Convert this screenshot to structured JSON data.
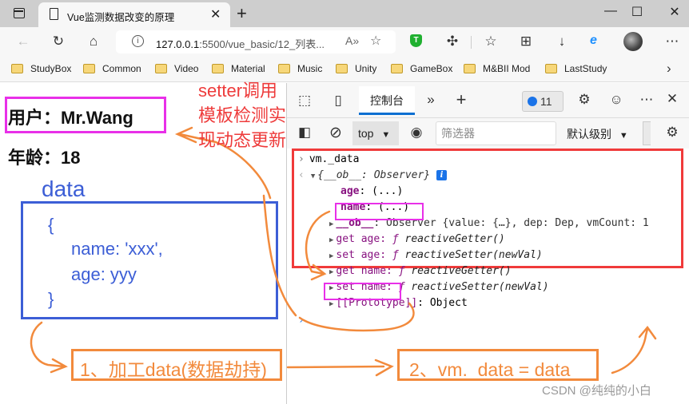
{
  "browser": {
    "tab_title": "Vue监测数据改变的原理",
    "url_host": "127.0.0.1",
    "url_rest": ":5500/vue_basic/12_列表...",
    "bookmarks": [
      "StudyBox",
      "Common",
      "Video",
      "Material",
      "Music",
      "Unity",
      "GameBox",
      "M&BII Mod",
      "LastStudy"
    ]
  },
  "page": {
    "user_label": "用户：Mr.Wang",
    "age_label": "年龄：18"
  },
  "annotations": {
    "setter_note": [
      "setter调用",
      "模板检测实",
      "现动态更新"
    ],
    "data_title": "data",
    "data_object": [
      "{",
      "name: 'xxx',",
      "age: yyy",
      "}"
    ],
    "step1": "1、加工data(数据劫持)",
    "step2": "2、vm._data = data",
    "colors": {
      "red": "#ee3b3b",
      "magenta": "#e830e8",
      "blue": "#3c5ed6",
      "orange": "#f28a3c"
    }
  },
  "devtools": {
    "console_tab": "控制台",
    "issues_count": "11",
    "context": "top",
    "filter_placeholder": "筛选器",
    "level": "默认级别",
    "input": "vm._data",
    "object_summary": "{__ob__: Observer}",
    "lines": [
      {
        "key": "age",
        "value": ": (...)"
      },
      {
        "key": "name",
        "value": ": (...)"
      },
      {
        "key": "__ob__",
        "value": ": Observer {value: {…}, dep: Dep, vmCount: 1"
      },
      {
        "key": "get age",
        "value": "reactiveGetter()"
      },
      {
        "key": "set age",
        "value": "reactiveSetter(newVal)"
      },
      {
        "key": "get name",
        "value": "reactiveGetter()"
      },
      {
        "key": "set name",
        "value": "reactiveSetter(newVal)"
      },
      {
        "key": "[[Prototype]]",
        "value": ": Object"
      }
    ]
  },
  "watermark": "CSDN @纯纯的小白"
}
